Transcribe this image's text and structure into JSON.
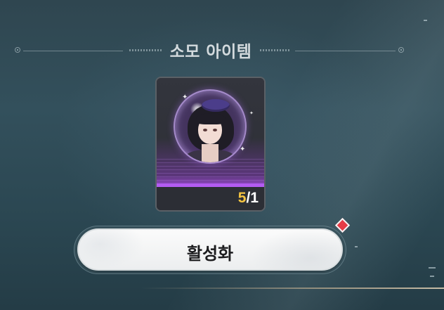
{
  "header": {
    "title": "소모 아이템"
  },
  "item": {
    "owned": "5",
    "separator": "/",
    "required": "1"
  },
  "activate_button": {
    "label": "활성화"
  },
  "colors": {
    "owned_count": "#f5c441",
    "notification": "#e63b46",
    "item_glow": "#b35cf2"
  }
}
